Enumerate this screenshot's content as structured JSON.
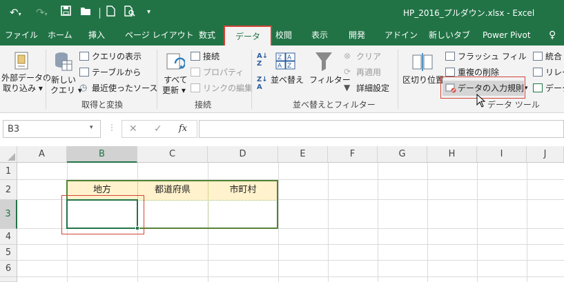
{
  "window": {
    "title": "HP_2016_プルダウン.xlsx  -  Excel"
  },
  "quick_access": {
    "icons": [
      "undo-icon",
      "redo-icon",
      "save-icon",
      "open-folder-icon",
      "new-file-icon",
      "print-preview-icon",
      "customize-dropdown-icon"
    ]
  },
  "tabs": [
    {
      "label": "ファイル"
    },
    {
      "label": "ホーム"
    },
    {
      "label": "挿入"
    },
    {
      "label": "ページ レイアウト"
    },
    {
      "label": "数式"
    },
    {
      "label": "データ",
      "active": true
    },
    {
      "label": "校閲"
    },
    {
      "label": "表示"
    },
    {
      "label": "開発"
    },
    {
      "label": "アドイン"
    },
    {
      "label": "新しいタブ"
    },
    {
      "label": "Power Pivot"
    }
  ],
  "ribbon": {
    "external_data": {
      "line1": "外部データの",
      "line2": "取り込み ▾"
    },
    "new_query": {
      "line1": "新しい",
      "line2": "クエリ ▾"
    },
    "show_queries": "クエリの表示",
    "from_table": "テーブルから",
    "recent_sources": "最近使ったソース",
    "group_get_transform": "取得と変換",
    "refresh_all": {
      "line1": "すべて",
      "line2": "更新 ▾"
    },
    "connections": "接続",
    "properties": "プロパティ",
    "edit_links": "リンクの編集",
    "group_connections": "接続",
    "sort": "並べ替え",
    "filter": "フィルター",
    "clear": "クリア",
    "reapply": "再適用",
    "advanced": "詳細設定",
    "group_sort_filter": "並べ替えとフィルター",
    "text_to_columns": "区切り位置",
    "flash_fill": "フラッシュ フィル",
    "remove_duplicates": "重複の削除",
    "data_validation": "データの入力規則",
    "group_data_tools": "データ ツール",
    "consolidate": "統合",
    "relationships": "リレー",
    "data_model": "データ"
  },
  "formula_bar": {
    "name_box": "B3",
    "fx": "fx",
    "cancel": "✕",
    "enter": "✓",
    "formula": ""
  },
  "sheet": {
    "columns": [
      "A",
      "B",
      "C",
      "D",
      "E",
      "F",
      "G",
      "H",
      "I",
      "J"
    ],
    "rows": [
      "1",
      "2",
      "3",
      "4",
      "5",
      "6"
    ],
    "headers_row2": {
      "B": "地方",
      "C": "都道府県",
      "D": "市町村"
    },
    "selected_cell": "B3"
  },
  "colors": {
    "excel_green": "#217346",
    "ribbon_bg": "#f3f3f3",
    "highlight_red": "#d04437",
    "header_fill": "#fff2cc",
    "table_border": "#548235"
  }
}
